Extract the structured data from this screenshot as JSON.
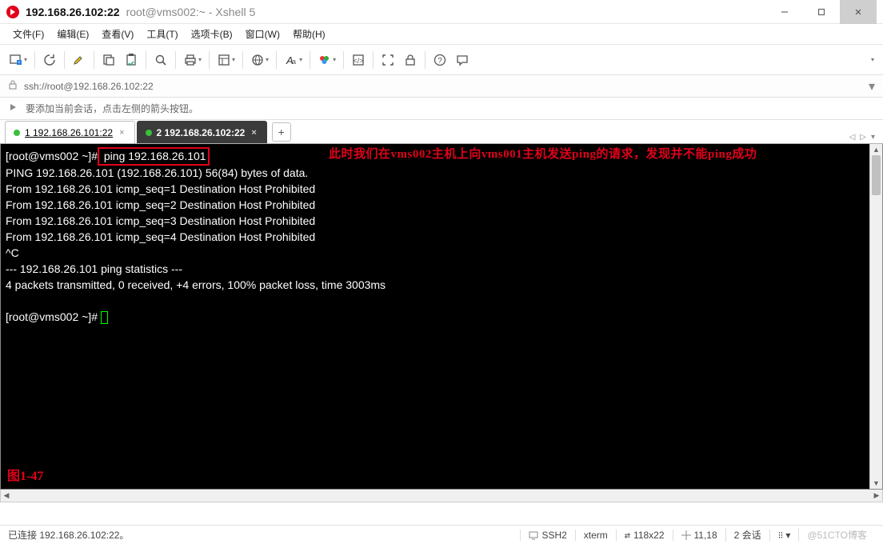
{
  "title": {
    "address": "192.168.26.102:22",
    "rest": "root@vms002:~ - Xshell 5"
  },
  "menu": [
    "文件(F)",
    "编辑(E)",
    "查看(V)",
    "工具(T)",
    "选项卡(B)",
    "窗口(W)",
    "帮助(H)"
  ],
  "addressbar": {
    "url": "ssh://root@192.168.26.102:22"
  },
  "infobar": {
    "text": "要添加当前会话，点击左侧的箭头按钮。"
  },
  "tabs": {
    "items": [
      {
        "label": "1 192.168.26.101:22",
        "active": false
      },
      {
        "label": "2 192.168.26.102:22",
        "active": true
      }
    ]
  },
  "terminal": {
    "prompt1_pre": "[root@vms002 ~]#",
    "cmd": " ping 192.168.26.101",
    "lines": [
      "PING 192.168.26.101 (192.168.26.101) 56(84) bytes of data.",
      "From 192.168.26.101 icmp_seq=1 Destination Host Prohibited",
      "From 192.168.26.101 icmp_seq=2 Destination Host Prohibited",
      "From 192.168.26.101 icmp_seq=3 Destination Host Prohibited",
      "From 192.168.26.101 icmp_seq=4 Destination Host Prohibited",
      "^C",
      "--- 192.168.26.101 ping statistics ---",
      "4 packets transmitted, 0 received, +4 errors, 100% packet loss, time 3003ms",
      ""
    ],
    "prompt2": "[root@vms002 ~]# ",
    "annotation": "此时我们在vms002主机上向vms001主机发送ping的请求，发现并不能ping成功",
    "figure_label": "图1-47"
  },
  "status": {
    "left": "已连接 192.168.26.102:22。",
    "protocol": "SSH2",
    "term": "xterm",
    "size": "118x22",
    "cursor": "11,18",
    "sessions": "2 会话",
    "watermark": "@51CTO博客"
  }
}
